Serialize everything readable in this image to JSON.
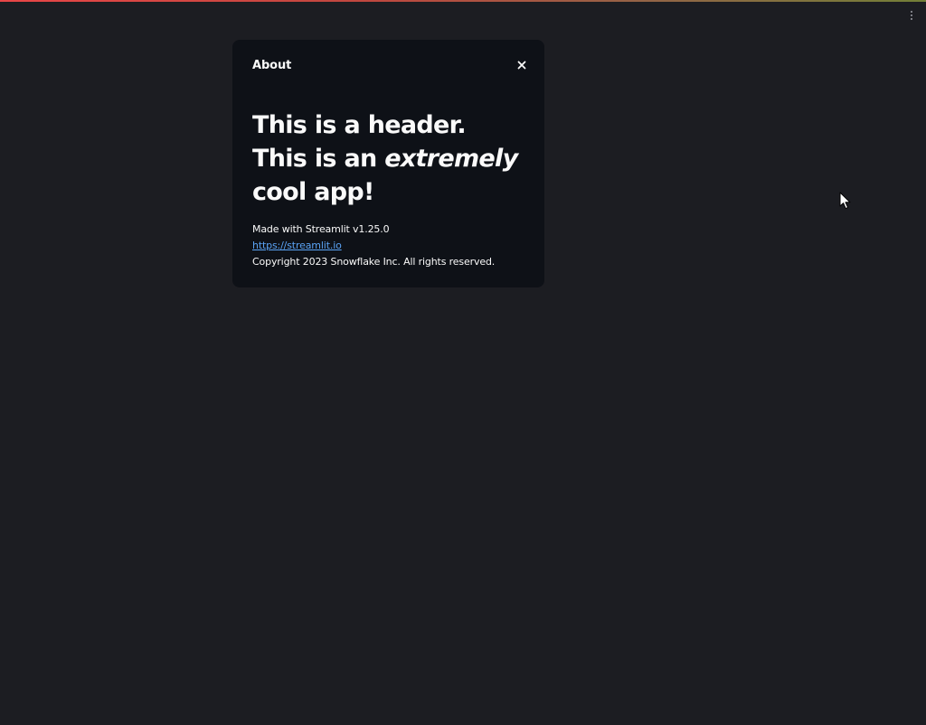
{
  "main_menu": {
    "icon": "kebab-menu-icon"
  },
  "about_dialog": {
    "title": "About",
    "close_icon": "close-icon",
    "header_part1": "This is a header. This is an ",
    "header_emphasis": "extremely",
    "header_part2": " cool app!",
    "made_with": "Made with Streamlit v1.25.0",
    "link_text": "https://streamlit.io",
    "copyright": "Copyright 2023 Snowflake Inc. All rights reserved."
  },
  "colors": {
    "page_background": "#1c1d22",
    "dialog_background": "#0e1117",
    "text": "#fafafa",
    "link": "#5aa3f5",
    "accent": "#ff4b4b"
  }
}
